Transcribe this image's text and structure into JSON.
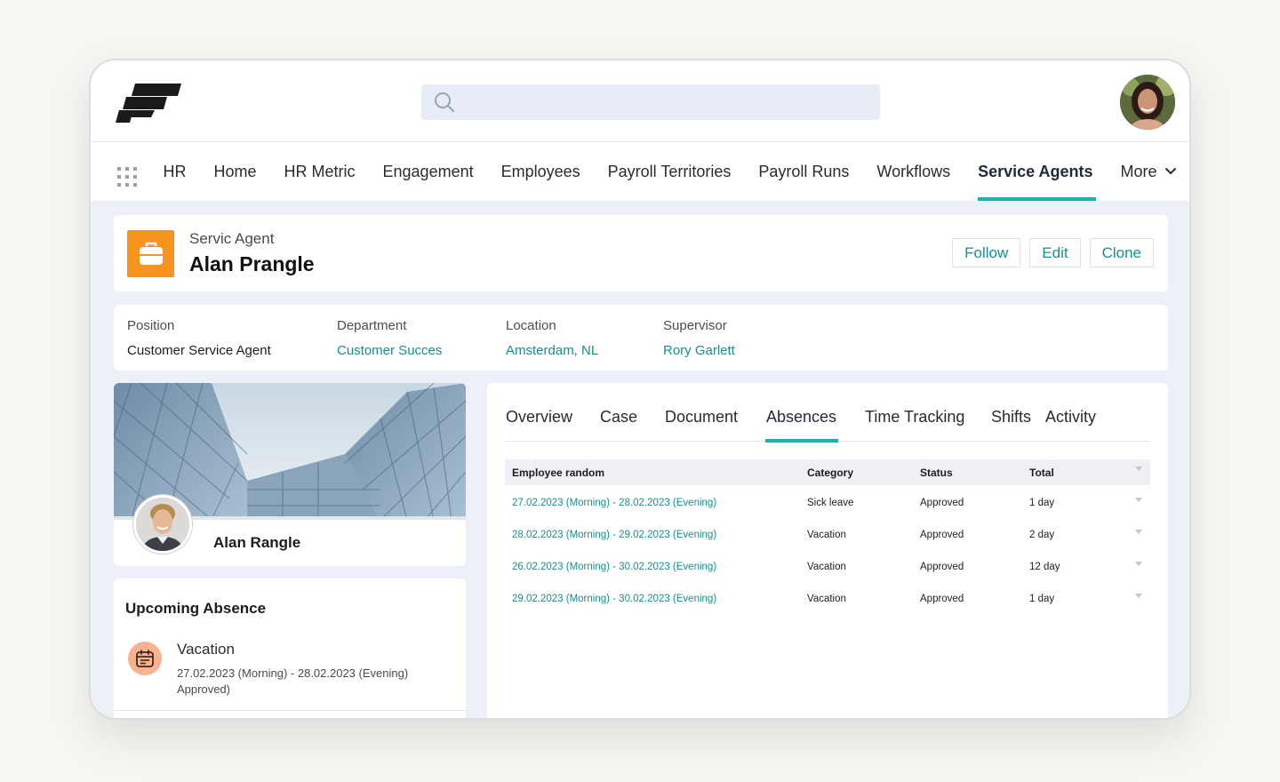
{
  "colors": {
    "accent": "#18b3ae",
    "link": "#15908d",
    "record_icon_bg": "#f7941d",
    "absence_icon_bg": "#f9b28f"
  },
  "topbar": {
    "logo_icon": "brand-logo-icon",
    "search_icon": "search-icon",
    "avatar_icon": "user-avatar"
  },
  "nav": {
    "apps_icon": "app-launcher-grid-icon",
    "items": [
      "HR",
      "Home",
      "HR Metric",
      "Engagement",
      "Employees",
      "Payroll Territories",
      "Payroll Runs",
      "Workflows",
      "Service Agents"
    ],
    "active": "Service Agents",
    "more_label": "More"
  },
  "record": {
    "icon": "briefcase-icon",
    "object_label": "Servic Agent",
    "title": "Alan Prangle",
    "actions": {
      "follow": "Follow",
      "edit": "Edit",
      "clone": "Clone"
    }
  },
  "details": {
    "position": {
      "label": "Position",
      "value": "Customer Service Agent"
    },
    "department": {
      "label": "Department",
      "value": "Customer Succes"
    },
    "location": {
      "label": "Location",
      "value": "Amsterdam, NL"
    },
    "supervisor": {
      "label": "Supervisor",
      "value": "Rory Garlett"
    }
  },
  "profile": {
    "name": "Alan Rangle"
  },
  "upcoming": {
    "title": "Upcoming Absence",
    "icon": "calendar-icon",
    "type": "Vacation",
    "range": "27.02.2023 (Morning) - 28.02.2023 (Evening)",
    "status": "Approved)"
  },
  "tabs": {
    "items": [
      "Overview",
      "Case",
      "Document",
      "Absences",
      "Time Tracking",
      "Shifts",
      "Activity"
    ],
    "active": "Absences"
  },
  "table": {
    "headers": {
      "employee": "Employee random",
      "category": "Category",
      "status": "Status",
      "total": "Total"
    },
    "rows": [
      {
        "range": "27.02.2023 (Morning) - 28.02.2023 (Evening)",
        "category": "Sick leave",
        "status": "Approved",
        "total": "1 day"
      },
      {
        "range": "28.02.2023 (Morning) - 29.02.2023 (Evening)",
        "category": "Vacation",
        "status": "Approved",
        "total": "2 day"
      },
      {
        "range": "26.02.2023 (Morning) - 30.02.2023 (Evening)",
        "category": "Vacation",
        "status": "Approved",
        "total": "12 day"
      },
      {
        "range": "29.02.2023 (Morning) - 30.02.2023 (Evening)",
        "category": "Vacation",
        "status": "Approved",
        "total": "1 day"
      }
    ]
  }
}
